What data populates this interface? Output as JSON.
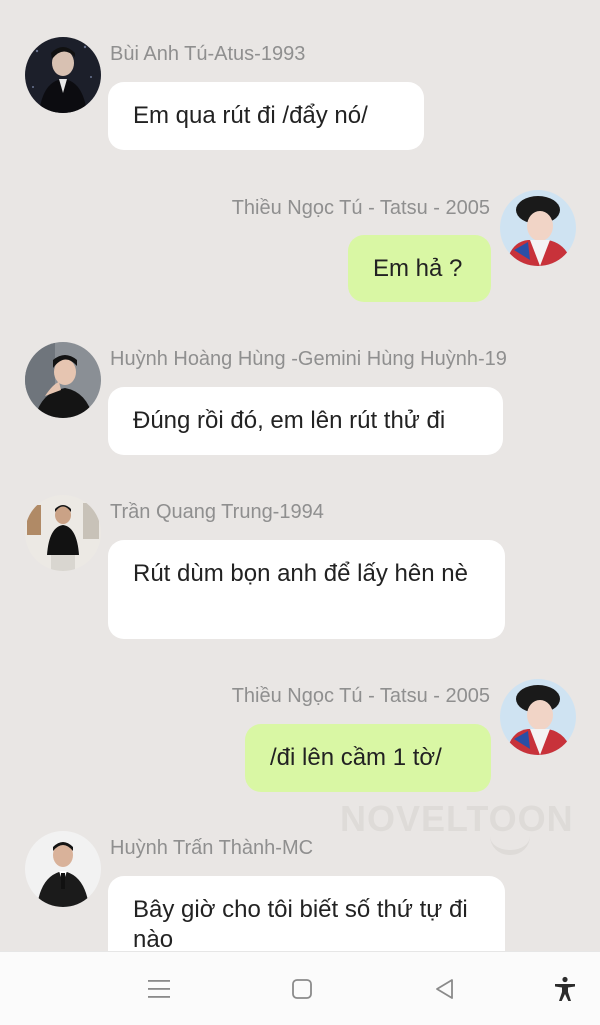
{
  "messages": [
    {
      "sender": "Bùi Anh Tú-Atus-1993",
      "text": "Em qua rút đi /đẩy nó/",
      "side": "in"
    },
    {
      "sender": "Thiều Ngọc Tú - Tatsu - 2005",
      "text": "Em hả ?",
      "side": "out"
    },
    {
      "sender": "Huỳnh Hoàng Hùng -Gemini Hùng Huỳnh-19",
      "text": "Đúng rồi đó, em lên rút thử đi",
      "side": "in"
    },
    {
      "sender": "Trần Quang Trung-1994",
      "text": "Rút dùm bọn anh để lấy hên nè",
      "side": "in"
    },
    {
      "sender": "Thiều Ngọc Tú - Tatsu - 2005",
      "text": "/đi lên cầm 1 tờ/",
      "side": "out"
    },
    {
      "sender": "Huỳnh Trấn Thành-MC",
      "text": "Bây giờ cho tôi biết số thứ tự đi nào",
      "side": "in"
    }
  ],
  "watermark": {
    "text": "NOVELTOON"
  },
  "navbar": {
    "icons": [
      "menu-icon",
      "home-square-icon",
      "back-triangle-icon",
      "accessibility-icon"
    ]
  },
  "colors": {
    "background": "#e9e6e4",
    "incoming_bubble": "#ffffff",
    "outgoing_bubble": "#d9f7a4",
    "sender_text": "#8f8f8f"
  }
}
